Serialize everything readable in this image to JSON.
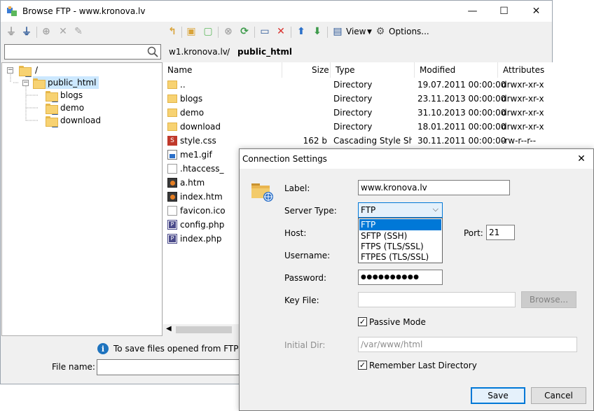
{
  "window": {
    "title": "Browse FTP - www.kronova.lv",
    "controls": {
      "minimize": "—",
      "maximize": "☐",
      "close": "✕"
    }
  },
  "toolbar": {
    "view_label": "View",
    "options_label": "Options..."
  },
  "search": {
    "placeholder": ""
  },
  "tree": {
    "root": "/",
    "items": [
      {
        "label": "public_html",
        "level": 1
      },
      {
        "label": "blogs",
        "level": 2
      },
      {
        "label": "demo",
        "level": 2
      },
      {
        "label": "download",
        "level": 2
      }
    ]
  },
  "breadcrumb": {
    "host": "w1.kronova.lv",
    "separator": "/",
    "folder": "public_html"
  },
  "filelist": {
    "columns": [
      "Name",
      "Size",
      "Type",
      "Modified",
      "Attributes"
    ],
    "rows": [
      {
        "icon": "folder-icon",
        "name": "..",
        "size": "",
        "type": "Directory",
        "modified": "19.07.2011 00:00:00",
        "attributes": "drwxr-xr-x"
      },
      {
        "icon": "folder-icon",
        "name": "blogs",
        "size": "",
        "type": "Directory",
        "modified": "23.11.2013 00:00:00",
        "attributes": "drwxr-xr-x"
      },
      {
        "icon": "folder-icon",
        "name": "demo",
        "size": "",
        "type": "Directory",
        "modified": "31.10.2013 00:00:00",
        "attributes": "drwxr-xr-x"
      },
      {
        "icon": "folder-icon",
        "name": "download",
        "size": "",
        "type": "Directory",
        "modified": "18.01.2011 00:00:00",
        "attributes": "drwxr-xr-x"
      },
      {
        "icon": "css-file-icon",
        "name": "style.css",
        "size": "162 b",
        "type": "Cascading Style Sh...",
        "modified": "30.11.2011 00:00:00",
        "attributes": "-rw-r--r--"
      },
      {
        "icon": "image-file-icon",
        "name": "me1.gif",
        "size": "",
        "type": "",
        "modified": "",
        "attributes": ""
      },
      {
        "icon": "text-file-icon",
        "name": ".htaccess_",
        "size": "",
        "type": "",
        "modified": "",
        "attributes": ""
      },
      {
        "icon": "html-file-icon",
        "name": "a.htm",
        "size": "",
        "type": "",
        "modified": "",
        "attributes": ""
      },
      {
        "icon": "html-file-icon",
        "name": "index.htm",
        "size": "",
        "type": "",
        "modified": "",
        "attributes": ""
      },
      {
        "icon": "text-file-icon",
        "name": "favicon.ico",
        "size": "",
        "type": "",
        "modified": "",
        "attributes": ""
      },
      {
        "icon": "php-file-icon",
        "name": "config.php",
        "size": "",
        "type": "",
        "modified": "",
        "attributes": ""
      },
      {
        "icon": "php-file-icon",
        "name": "index.php",
        "size": "",
        "type": "",
        "modified": "",
        "attributes": ""
      }
    ]
  },
  "footer": {
    "info": "To save files opened from FTP, you",
    "filename_label": "File name:",
    "filename_value": ""
  },
  "dialog": {
    "title": "Connection Settings",
    "close": "✕",
    "label_caption": "Label:",
    "label_value": "www.kronova.lv",
    "server_type_caption": "Server Type:",
    "server_type_value": "FTP",
    "server_type_options": [
      "FTP",
      "SFTP (SSH)",
      "FTPS (TLS/SSL)",
      "FTPES (TLS/SSL)"
    ],
    "host_caption": "Host:",
    "port_caption": "Port:",
    "port_value": "21",
    "username_caption": "Username:",
    "password_caption": "Password:",
    "password_value": "●●●●●●●●●●",
    "keyfile_caption": "Key File:",
    "browse_label": "Browse...",
    "passive_label": "Passive Mode",
    "passive_checked": true,
    "initial_dir_caption": "Initial Dir:",
    "initial_dir_value": "/var/www/html",
    "remember_label": "Remember Last Directory",
    "remember_checked": true,
    "save_label": "Save",
    "cancel_label": "Cancel"
  }
}
